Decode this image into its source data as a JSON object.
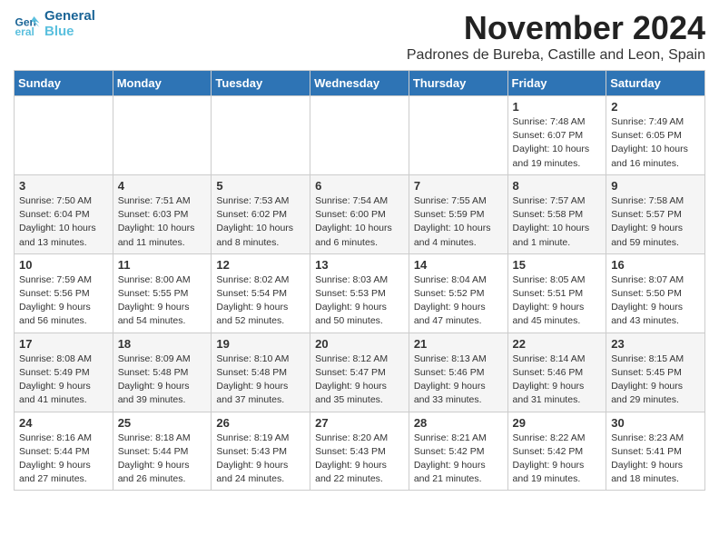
{
  "logo": {
    "line1": "General",
    "line2": "Blue"
  },
  "title": "November 2024",
  "subtitle": "Padrones de Bureba, Castille and Leon, Spain",
  "weekdays": [
    "Sunday",
    "Monday",
    "Tuesday",
    "Wednesday",
    "Thursday",
    "Friday",
    "Saturday"
  ],
  "weeks": [
    [
      {
        "day": "",
        "info": ""
      },
      {
        "day": "",
        "info": ""
      },
      {
        "day": "",
        "info": ""
      },
      {
        "day": "",
        "info": ""
      },
      {
        "day": "",
        "info": ""
      },
      {
        "day": "1",
        "info": "Sunrise: 7:48 AM\nSunset: 6:07 PM\nDaylight: 10 hours and 19 minutes."
      },
      {
        "day": "2",
        "info": "Sunrise: 7:49 AM\nSunset: 6:05 PM\nDaylight: 10 hours and 16 minutes."
      }
    ],
    [
      {
        "day": "3",
        "info": "Sunrise: 7:50 AM\nSunset: 6:04 PM\nDaylight: 10 hours and 13 minutes."
      },
      {
        "day": "4",
        "info": "Sunrise: 7:51 AM\nSunset: 6:03 PM\nDaylight: 10 hours and 11 minutes."
      },
      {
        "day": "5",
        "info": "Sunrise: 7:53 AM\nSunset: 6:02 PM\nDaylight: 10 hours and 8 minutes."
      },
      {
        "day": "6",
        "info": "Sunrise: 7:54 AM\nSunset: 6:00 PM\nDaylight: 10 hours and 6 minutes."
      },
      {
        "day": "7",
        "info": "Sunrise: 7:55 AM\nSunset: 5:59 PM\nDaylight: 10 hours and 4 minutes."
      },
      {
        "day": "8",
        "info": "Sunrise: 7:57 AM\nSunset: 5:58 PM\nDaylight: 10 hours and 1 minute."
      },
      {
        "day": "9",
        "info": "Sunrise: 7:58 AM\nSunset: 5:57 PM\nDaylight: 9 hours and 59 minutes."
      }
    ],
    [
      {
        "day": "10",
        "info": "Sunrise: 7:59 AM\nSunset: 5:56 PM\nDaylight: 9 hours and 56 minutes."
      },
      {
        "day": "11",
        "info": "Sunrise: 8:00 AM\nSunset: 5:55 PM\nDaylight: 9 hours and 54 minutes."
      },
      {
        "day": "12",
        "info": "Sunrise: 8:02 AM\nSunset: 5:54 PM\nDaylight: 9 hours and 52 minutes."
      },
      {
        "day": "13",
        "info": "Sunrise: 8:03 AM\nSunset: 5:53 PM\nDaylight: 9 hours and 50 minutes."
      },
      {
        "day": "14",
        "info": "Sunrise: 8:04 AM\nSunset: 5:52 PM\nDaylight: 9 hours and 47 minutes."
      },
      {
        "day": "15",
        "info": "Sunrise: 8:05 AM\nSunset: 5:51 PM\nDaylight: 9 hours and 45 minutes."
      },
      {
        "day": "16",
        "info": "Sunrise: 8:07 AM\nSunset: 5:50 PM\nDaylight: 9 hours and 43 minutes."
      }
    ],
    [
      {
        "day": "17",
        "info": "Sunrise: 8:08 AM\nSunset: 5:49 PM\nDaylight: 9 hours and 41 minutes."
      },
      {
        "day": "18",
        "info": "Sunrise: 8:09 AM\nSunset: 5:48 PM\nDaylight: 9 hours and 39 minutes."
      },
      {
        "day": "19",
        "info": "Sunrise: 8:10 AM\nSunset: 5:48 PM\nDaylight: 9 hours and 37 minutes."
      },
      {
        "day": "20",
        "info": "Sunrise: 8:12 AM\nSunset: 5:47 PM\nDaylight: 9 hours and 35 minutes."
      },
      {
        "day": "21",
        "info": "Sunrise: 8:13 AM\nSunset: 5:46 PM\nDaylight: 9 hours and 33 minutes."
      },
      {
        "day": "22",
        "info": "Sunrise: 8:14 AM\nSunset: 5:46 PM\nDaylight: 9 hours and 31 minutes."
      },
      {
        "day": "23",
        "info": "Sunrise: 8:15 AM\nSunset: 5:45 PM\nDaylight: 9 hours and 29 minutes."
      }
    ],
    [
      {
        "day": "24",
        "info": "Sunrise: 8:16 AM\nSunset: 5:44 PM\nDaylight: 9 hours and 27 minutes."
      },
      {
        "day": "25",
        "info": "Sunrise: 8:18 AM\nSunset: 5:44 PM\nDaylight: 9 hours and 26 minutes."
      },
      {
        "day": "26",
        "info": "Sunrise: 8:19 AM\nSunset: 5:43 PM\nDaylight: 9 hours and 24 minutes."
      },
      {
        "day": "27",
        "info": "Sunrise: 8:20 AM\nSunset: 5:43 PM\nDaylight: 9 hours and 22 minutes."
      },
      {
        "day": "28",
        "info": "Sunrise: 8:21 AM\nSunset: 5:42 PM\nDaylight: 9 hours and 21 minutes."
      },
      {
        "day": "29",
        "info": "Sunrise: 8:22 AM\nSunset: 5:42 PM\nDaylight: 9 hours and 19 minutes."
      },
      {
        "day": "30",
        "info": "Sunrise: 8:23 AM\nSunset: 5:41 PM\nDaylight: 9 hours and 18 minutes."
      }
    ]
  ]
}
